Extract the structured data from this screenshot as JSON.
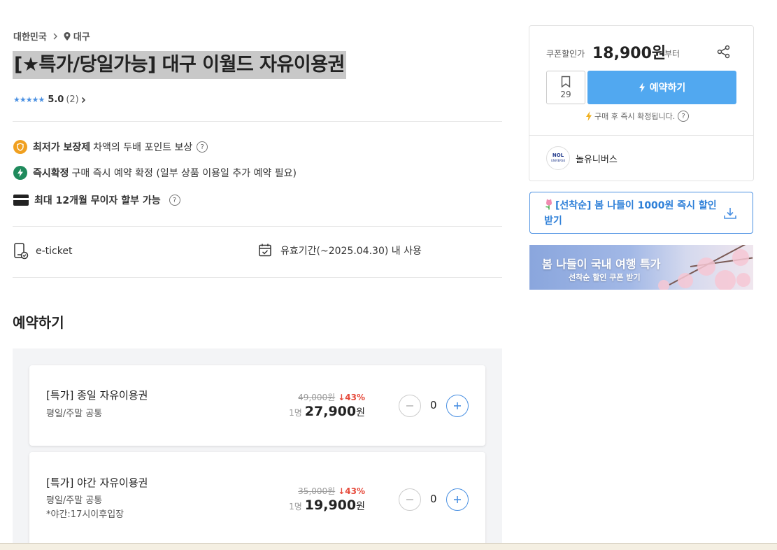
{
  "breadcrumb": {
    "country": "대한민국",
    "city": "대구"
  },
  "product": {
    "title": "[★특가/당일가능] 대구 이월드 자유이용권",
    "rating": "5.0",
    "review_count": "(2)"
  },
  "features": [
    {
      "bold": "최저가 보장제",
      "text": "차액의 두배 포인트 보상",
      "help": "?"
    },
    {
      "bold": "즉시확정",
      "text": "구매 즉시 예약 확정 (일부 상품 이용일 추가 예약 필요)"
    },
    {
      "bold": "최대 12개월 무이자 할부 가능",
      "text": "",
      "help": "?"
    }
  ],
  "info": {
    "ticket_type": "e-ticket",
    "validity": "유효기간(~2025.04.30) 내 사용"
  },
  "booking_section_title": "예약하기",
  "options": [
    {
      "name": "[특가] 종일 자유이용권",
      "sub1": "평일/주말 공통",
      "sub2": "",
      "original_price": "49,000원",
      "discount": "43%",
      "per": "1명",
      "price": "27,900",
      "currency": "원",
      "qty": "0"
    },
    {
      "name": "[특가] 야간 자유이용권",
      "sub1": "평일/주말 공통",
      "sub2": "*야간:17시이후입장",
      "original_price": "35,000원",
      "discount": "43%",
      "per": "1명",
      "price": "19,900",
      "currency": "원",
      "qty": "0"
    }
  ],
  "sidebar": {
    "coupon_label": "쿠폰할인가",
    "coupon_price": "18,900원",
    "coupon_suffix": "부터",
    "wishlist_count": "29",
    "book_label": "예약하기",
    "confirm_note": "구매 후 즉시 확정됩니다.",
    "help": "?",
    "seller_logo_line1": "NOL",
    "seller_logo_line2": "UNIVERSE",
    "seller_name": "놀유니버스"
  },
  "coupon_banner": {
    "text": "[선착순] 봄 나들이 1000원 즉시 할인 받기",
    "icon": "tulip-icon"
  },
  "promo": {
    "headline": "봄 나들이 국내 여행 특가",
    "subline": "선착순 할인 쿠폰 받기"
  },
  "colors": {
    "accent": "#51a8f0",
    "discount": "#e64a3b",
    "shield": "#f0a020",
    "instant": "#1f8a5c"
  }
}
